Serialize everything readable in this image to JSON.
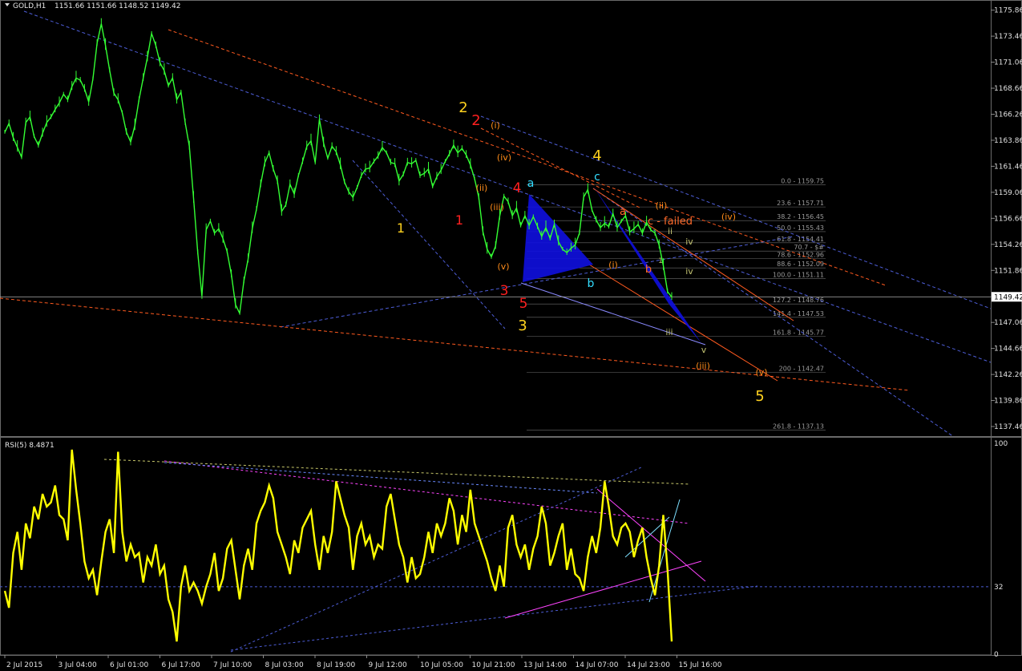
{
  "header": {
    "symbol_text": "GOLD,H1",
    "ohlc_text": "1151.66 1151.66 1148.52 1149.42"
  },
  "rsi_header": {
    "text": "RSI(5) 8.4871"
  },
  "current_price_label": "1149.42",
  "colors": {
    "background": "#000000",
    "price_line": "#33ff33",
    "rsi_line": "#ffff00",
    "channel_blue": "#4d5dd6",
    "channel_red": "#ff5a1f",
    "pattern_fill": "#1010e0",
    "pink": "#ff44ff",
    "fib_line": "#9a9a9a"
  },
  "chart_data": [
    {
      "type": "line",
      "title": "GOLD,H1",
      "ylim": [
        1136.5,
        1176.5
      ],
      "grid": false,
      "price_ticks": [
        "1175.86",
        "1173.46",
        "1171.06",
        "1168.66",
        "1166.26",
        "1163.86",
        "1161.46",
        "1159.06",
        "1156.66",
        "1154.26",
        "1151.86",
        "1149.46",
        "1147.06",
        "1144.66",
        "1142.26",
        "1139.86",
        "1137.46"
      ],
      "x_ticks": [
        "2 Jul 2015",
        "3 Jul 04:00",
        "6 Jul 01:00",
        "6 Jul 17:00",
        "7 Jul 10:00",
        "8 Jul 03:00",
        "8 Jul 19:00",
        "9 Jul 12:00",
        "10 Jul 05:00",
        "10 Jul 21:00",
        "13 Jul 14:00",
        "14 Jul 07:00",
        "14 Jul 23:00",
        "15 Jul 16:00"
      ],
      "series": [
        {
          "values": [
            1164.6,
            1165.4,
            1164.1,
            1163.2,
            1162.3,
            1165.5,
            1166.0,
            1164.2,
            1163.4,
            1164.5,
            1165.5,
            1166.0,
            1166.7,
            1167.3,
            1168.1,
            1167.6,
            1168.8,
            1169.6,
            1169.4,
            1168.6,
            1167.4,
            1169.5,
            1172.8,
            1174.6,
            1172.6,
            1170.3,
            1168.2,
            1167.6,
            1166.4,
            1164.6,
            1163.7,
            1165.2,
            1167.6,
            1169.6,
            1171.5,
            1173.7,
            1172.6,
            1171.0,
            1170.3,
            1168.9,
            1169.6,
            1167.6,
            1168.3,
            1165.5,
            1163.3,
            1158.5,
            1153.5,
            1149.5,
            1155.6,
            1156.4,
            1155.3,
            1155.7,
            1154.8,
            1153.6,
            1151.5,
            1148.7,
            1147.9,
            1150.9,
            1152.9,
            1155.7,
            1157.5,
            1159.8,
            1161.8,
            1162.7,
            1161.2,
            1160.1,
            1157.3,
            1157.9,
            1159.8,
            1158.9,
            1160.6,
            1161.9,
            1163.3,
            1163.8,
            1161.8,
            1165.8,
            1163.6,
            1162.2,
            1163.3,
            1162.8,
            1161.6,
            1160.0,
            1159.1,
            1158.6,
            1159.5,
            1160.6,
            1161.2,
            1161.3,
            1161.9,
            1162.4,
            1163.2,
            1162.7,
            1161.8,
            1161.7,
            1160.1,
            1160.7,
            1161.8,
            1161.7,
            1162.0,
            1160.6,
            1160.8,
            1161.2,
            1159.6,
            1160.5,
            1161.1,
            1161.9,
            1162.6,
            1163.4,
            1162.7,
            1163.1,
            1162.5,
            1161.6,
            1160.3,
            1158.6,
            1155.4,
            1153.8,
            1153.1,
            1154.1,
            1156.9,
            1158.7,
            1158.2,
            1156.9,
            1157.6,
            1156.0,
            1156.9,
            1156.0,
            1156.8,
            1155.9,
            1155.0,
            1155.8,
            1154.8,
            1156.1,
            1154.5,
            1153.8,
            1153.5,
            1153.9,
            1154.2,
            1155.3,
            1158.6,
            1159.3,
            1157.4,
            1156.5,
            1155.8,
            1156.2,
            1155.9,
            1157.1,
            1155.8,
            1156.4,
            1156.9,
            1155.4,
            1155.7,
            1156.1,
            1155.3,
            1156.3,
            1155.6,
            1155.3,
            1154.2,
            1152.3,
            1149.9,
            1149.4
          ]
        }
      ],
      "elliott_labels": [
        "1",
        "2",
        "3",
        "4",
        "5",
        "1",
        "2",
        "3",
        "4",
        "5",
        "(i)",
        "(ii)",
        "(iii)",
        "(iv)",
        "(v)",
        "a",
        "b",
        "c",
        "a",
        "b",
        "c - failed",
        "(i)",
        "(ii)",
        "(iii)",
        "(iv)",
        "(v)",
        "ii",
        "iii",
        "iv",
        "iv",
        "v",
        "1"
      ],
      "fibonacci_levels": [
        {
          "label": "0.0 - 1159.75",
          "value": 1159.75
        },
        {
          "label": "23.6 - 1157.71",
          "value": 1157.71
        },
        {
          "label": "38.2 - 1156.45",
          "value": 1156.45
        },
        {
          "label": "50.0 - 1155.43",
          "value": 1155.43
        },
        {
          "label": "61.8 - 1154.41",
          "value": 1154.41
        },
        {
          "label": "70.7 - $#",
          "value": 1153.64
        },
        {
          "label": "78.6 - 1152.96",
          "value": 1152.96
        },
        {
          "label": "88.6 - 1152.09",
          "value": 1152.09
        },
        {
          "label": "100.0 - 1151.11",
          "value": 1151.11
        },
        {
          "label": "127.2 - 1148.76",
          "value": 1148.76
        },
        {
          "label": "141.4 - 1147.53",
          "value": 1147.53
        },
        {
          "label": "161.8 - 1145.77",
          "value": 1145.77
        },
        {
          "label": "200 - 1142.47",
          "value": 1142.47
        },
        {
          "label": "261.8 - 1137.13",
          "value": 1137.13
        }
      ]
    },
    {
      "type": "line",
      "title": "RSI(5) 8.4871",
      "ylim": [
        0,
        100
      ],
      "y_ticks": [
        "100",
        "32",
        "0"
      ],
      "series": [
        {
          "values": [
            30,
            22,
            48,
            58,
            40,
            62,
            55,
            70,
            64,
            76,
            70,
            72,
            80,
            66,
            64,
            54,
            97,
            78,
            62,
            44,
            36,
            40,
            28,
            44,
            58,
            64,
            48,
            96,
            58,
            44,
            52,
            46,
            48,
            34,
            46,
            42,
            52,
            38,
            42,
            26,
            20,
            6,
            32,
            42,
            30,
            34,
            30,
            24,
            32,
            38,
            48,
            30,
            36,
            50,
            54,
            40,
            26,
            42,
            50,
            40,
            62,
            68,
            72,
            80,
            74,
            58,
            52,
            46,
            38,
            54,
            48,
            60,
            64,
            68,
            52,
            40,
            56,
            48,
            58,
            82,
            74,
            66,
            60,
            40,
            56,
            62,
            52,
            56,
            46,
            52,
            50,
            70,
            76,
            64,
            52,
            46,
            34,
            46,
            36,
            38,
            46,
            58,
            48,
            62,
            56,
            62,
            74,
            68,
            52,
            66,
            58,
            78,
            62,
            56,
            50,
            44,
            36,
            30,
            42,
            32,
            60,
            66,
            52,
            46,
            52,
            40,
            50,
            56,
            70,
            62,
            42,
            48,
            56,
            62,
            40,
            50,
            38,
            36,
            30,
            46,
            56,
            48,
            60,
            82,
            70,
            56,
            52,
            60,
            62,
            58,
            46,
            54,
            60,
            46,
            36,
            28,
            42,
            66,
            40,
            6
          ]
        }
      ]
    }
  ]
}
